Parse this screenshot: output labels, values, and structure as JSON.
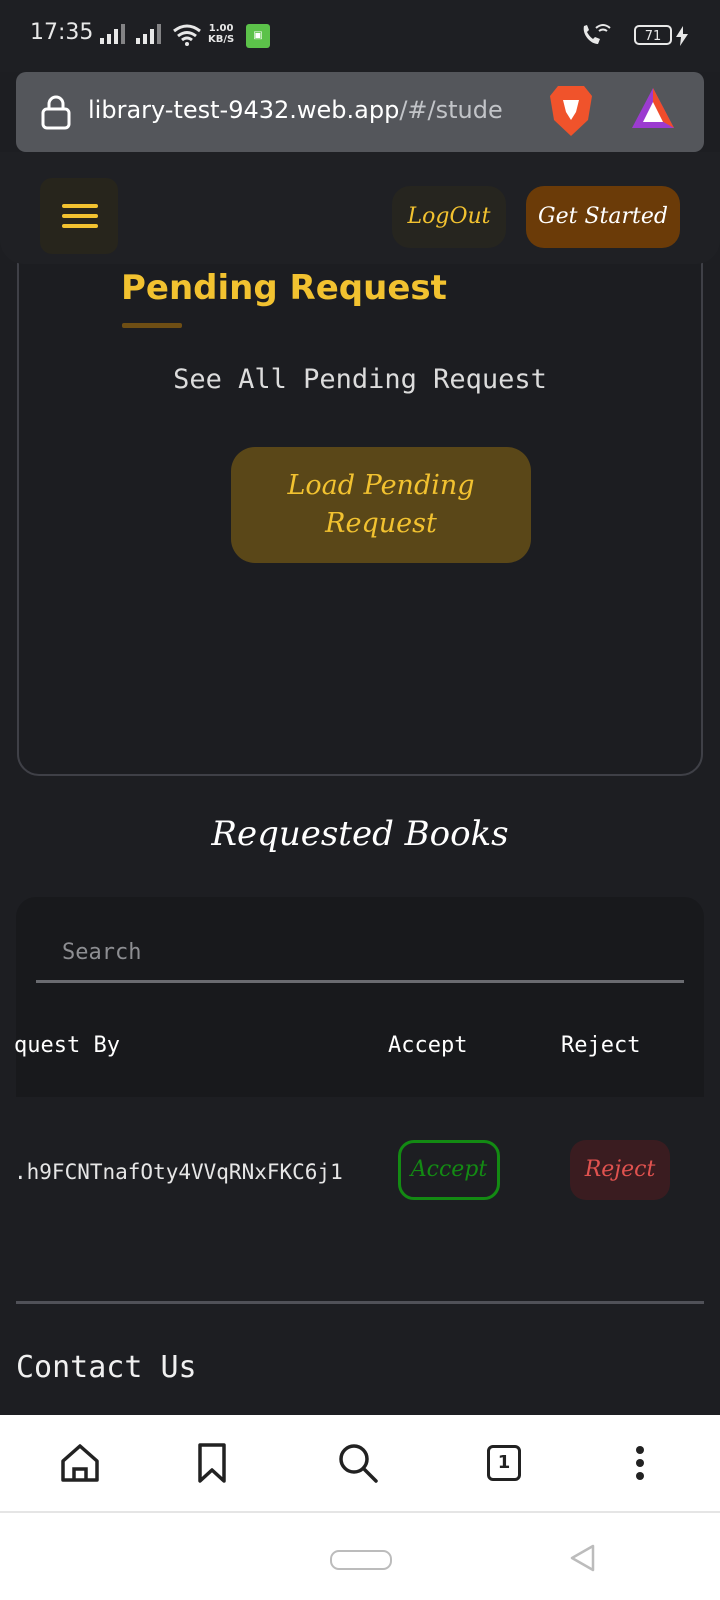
{
  "status_bar": {
    "time": "17:35",
    "speed_value": "1.00",
    "speed_unit": "KB/S",
    "battery": "71"
  },
  "browser": {
    "url_host": "library-test-9432.web.app",
    "url_path": "/#/stude"
  },
  "navbar": {
    "logout_label": "LogOut",
    "get_started_label": "Get Started"
  },
  "pending": {
    "title": "Pending Request",
    "subtitle": "See All Pending Request",
    "load_button": "Load Pending Request"
  },
  "requested": {
    "title": "Requested Books",
    "search_placeholder": "Search",
    "columns": [
      "quest By",
      "Accept",
      "Reject"
    ],
    "rows": [
      {
        "request_by": ".h9FCNTnafOty4VVqRNxFKC6j1",
        "accept_label": "Accept",
        "reject_label": "Reject"
      }
    ]
  },
  "footer": {
    "contact_title": "Contact Us"
  },
  "browser_bottom": {
    "tab_count": "1"
  },
  "colors": {
    "accent": "#f2c230",
    "accept": "#138a13",
    "reject": "#e0524f",
    "background": "#1d1e22"
  }
}
